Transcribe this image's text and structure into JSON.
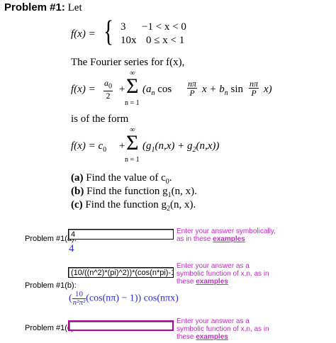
{
  "title": {
    "bold": "Problem #1:",
    "rest": "Let"
  },
  "piecewise": {
    "lhs": "f(x) =",
    "case1_val": "3",
    "case1_cond": "−1 < x < 0",
    "case2_val": "10x",
    "case2_cond": "0 ≤ x < 1"
  },
  "fourier_intro": "The Fourier series for f(x),",
  "series_eq": {
    "lhs": "f(x) =",
    "a0": "a",
    "a0_sub": "0",
    "den": "2",
    "plus": "+",
    "sum_top": "∞",
    "sum_bottom": "n = 1",
    "term_a": "(a",
    "sub_n": "n",
    "cos": "cos",
    "frac_num": "nπ",
    "frac_den": "P",
    "x_plus": "x +",
    "term_b": "b",
    "sin": "sin",
    "x_close": "x)"
  },
  "form_intro": "is of the form",
  "form_eq": {
    "lhs": "f(x) = c",
    "c_sub": "0",
    "plus": "+",
    "sum_top": "∞",
    "sum_bottom": "n = 1",
    "body": "(g",
    "g1_sub": "1",
    "g1_args": "(n,x) + g",
    "g2_sub": "2",
    "g2_args": "(n,x))"
  },
  "parts": [
    {
      "label": "(a)",
      "text": "Find the value of c",
      "sub": "0",
      "end": "."
    },
    {
      "label": "(b)",
      "text": "Find the function g",
      "sub": "1",
      "end": "(n, x)."
    },
    {
      "label": "(c)",
      "text": "Find the function g",
      "sub": "2",
      "end": "(n, x)."
    }
  ],
  "answers": [
    {
      "label": "Problem #1(a):",
      "value": "4",
      "preview": "4",
      "hint_text": "Enter your answer symbolically, as in these",
      "hint_link": "examples"
    },
    {
      "label": "Problem #1(b):",
      "value": "(10/((n^2)*(pi)^2))*(cos(n*pi)-1))*",
      "preview_prefix": "(",
      "preview_num": "10",
      "preview_den": "n²π²",
      "preview_rest": "(cos(nπ) − 1)) cos(nπx)",
      "hint_text": "Enter your answer as a symbolic function of x,n, as in these",
      "hint_link": "examples"
    },
    {
      "label": "Problem #1(c):",
      "value": "",
      "hint_text": "Enter your answer as a symbolic function of x,n, as in these",
      "hint_link": "examples"
    }
  ]
}
